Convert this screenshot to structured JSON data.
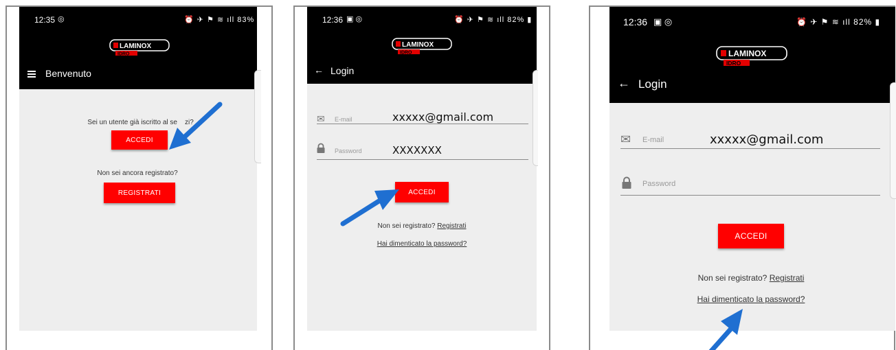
{
  "brand": {
    "logo_main": "LAMINOX",
    "logo_sub": "IDRO",
    "accent": "#ff0000"
  },
  "screen1": {
    "status_time": "12:35",
    "status_right": "83%",
    "title": "Benvenuto",
    "prompt_registered": "Sei un utente già iscritto al se",
    "prompt_tail": "zi?",
    "login_button": "ACCEDI",
    "prompt_not_registered": "Non sei ancora registrato?",
    "register_button": "REGISTRATI"
  },
  "screen2": {
    "status_time": "12:36",
    "status_right": "82%",
    "title": "Login",
    "email_label": "E-mail",
    "email_value": "xxxxx@gmail.com",
    "password_label": "Password",
    "password_value": "XXXXXXX",
    "login_button": "ACCEDI",
    "not_registered_text": "Non sei registrato?",
    "register_link": "Registrati",
    "forgot_link": "Hai dimenticato la password?"
  },
  "screen3": {
    "status_time": "12:36",
    "status_right": "82%",
    "title": "Login",
    "email_label": "E-mail",
    "email_value": "xxxxx@gmail.com",
    "password_label": "Password",
    "login_button": "ACCEDI",
    "not_registered_text": "Non sei registrato?",
    "register_link": "Registrati",
    "forgot_link": "Hai dimenticato la password?"
  },
  "icons": {
    "menu": "hamburger-menu-icon",
    "back": "arrow-back-icon",
    "email": "envelope-icon",
    "password": "lock-icon",
    "annotation": "blue-arrow-icon",
    "annotation_color": "#1f6fd1"
  }
}
